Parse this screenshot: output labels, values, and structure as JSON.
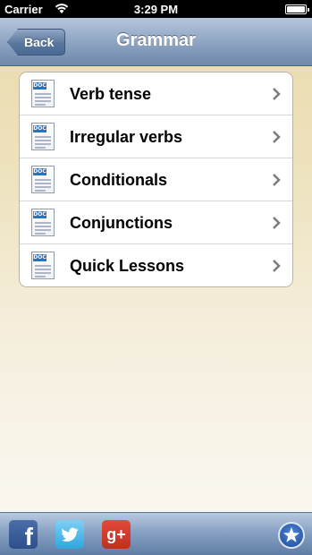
{
  "status_bar": {
    "carrier": "Carrier",
    "time": "3:29 PM"
  },
  "nav": {
    "back_label": "Back",
    "title": "Grammar"
  },
  "list": {
    "items": [
      {
        "label": "Verb tense",
        "icon": "doc-icon"
      },
      {
        "label": "Irregular verbs",
        "icon": "doc-icon"
      },
      {
        "label": "Conditionals",
        "icon": "doc-icon"
      },
      {
        "label": "Conjunctions",
        "icon": "doc-icon"
      },
      {
        "label": "Quick Lessons",
        "icon": "doc-icon"
      }
    ]
  },
  "doc_icon_tag": "DOC",
  "tab_bar": {
    "facebook_glyph": "f",
    "google_plus_glyph": "g+",
    "icons": [
      "facebook-icon",
      "twitter-icon",
      "google-plus-icon",
      "star-icon"
    ]
  },
  "colors": {
    "nav_bar": "#8ea5c3",
    "background": "#efe4c2",
    "facebook": "#3b5998",
    "twitter": "#2ea6e0",
    "google_plus": "#d03a2b"
  }
}
